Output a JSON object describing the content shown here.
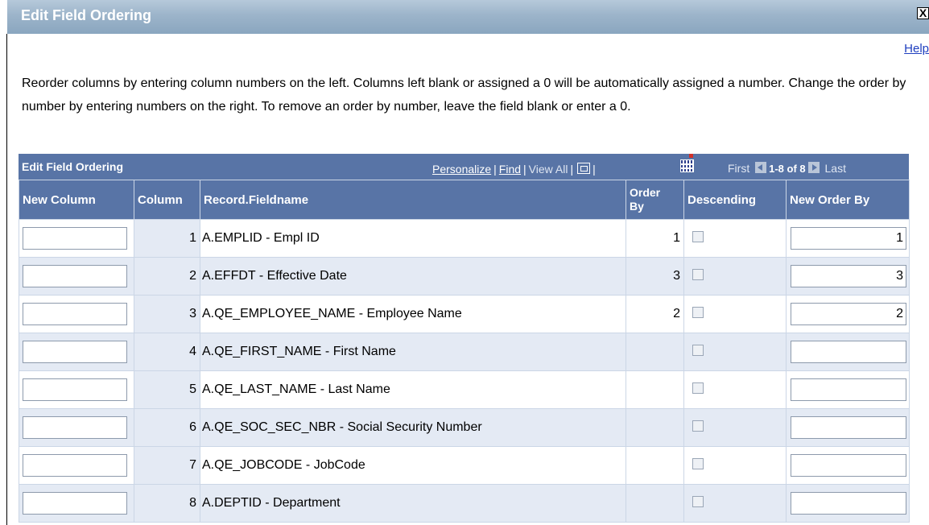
{
  "dialog": {
    "title": "Edit Field Ordering",
    "close_label": "X",
    "help_label": "Help",
    "instructions": "Reorder columns by entering column numbers on the left. Columns left blank or assigned a 0 will be automatically assigned a number. Change the order by number by entering numbers on the right. To remove an order by number, leave the field blank or enter a 0."
  },
  "grid": {
    "title": "Edit Field Ordering",
    "personalize_label": "Personalize",
    "find_label": "Find",
    "view_all_label": "View All",
    "zoom_icon": "zoom-icon",
    "grid_icon": "download-grid-icon",
    "first_label": "First",
    "range_label": "1-8 of 8",
    "last_label": "Last",
    "columns": {
      "new_column": "New Column",
      "column": "Column",
      "fieldname": "Record.Fieldname",
      "order_by_1": "Order",
      "order_by_2": "By",
      "descending": "Descending",
      "new_order_by": "New Order By"
    },
    "rows": [
      {
        "column": "1",
        "field": "A.EMPLID - Empl ID",
        "order_by": "1",
        "new_order_by": "1"
      },
      {
        "column": "2",
        "field": "A.EFFDT - Effective Date",
        "order_by": "3",
        "new_order_by": "3"
      },
      {
        "column": "3",
        "field": "A.QE_EMPLOYEE_NAME - Employee Name",
        "order_by": "2",
        "new_order_by": "2"
      },
      {
        "column": "4",
        "field": "A.QE_FIRST_NAME - First Name",
        "order_by": "",
        "new_order_by": ""
      },
      {
        "column": "5",
        "field": "A.QE_LAST_NAME - Last Name",
        "order_by": "",
        "new_order_by": ""
      },
      {
        "column": "6",
        "field": "A.QE_SOC_SEC_NBR - Social Security Number",
        "order_by": "",
        "new_order_by": ""
      },
      {
        "column": "7",
        "field": "A.QE_JOBCODE - JobCode",
        "order_by": "",
        "new_order_by": ""
      },
      {
        "column": "8",
        "field": "A.DEPTID - Department",
        "order_by": "",
        "new_order_by": ""
      }
    ]
  }
}
